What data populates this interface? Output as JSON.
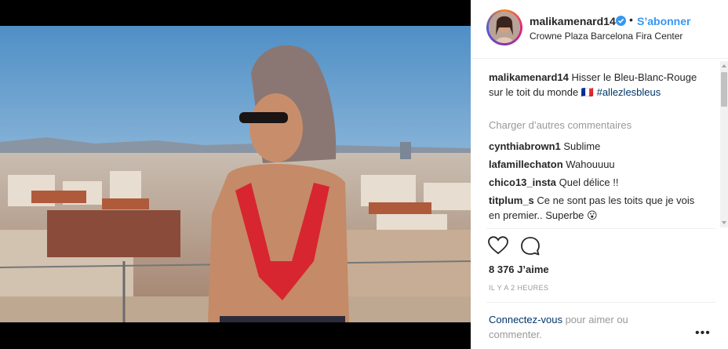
{
  "post": {
    "username": "malikamenard14",
    "follow_label": "S’abonner",
    "separator": "•",
    "location": "Crowne Plaza Barcelona Fira Center"
  },
  "caption": {
    "username": "malikamenard14",
    "text": " Hisser le Bleu-Blanc-Rouge sur le toit du monde 🇫🇷 ",
    "hashtag": "#allezlesbleus"
  },
  "load_more_label": "Charger d’autres commentaires",
  "comments": [
    {
      "username": "cynthiabrown1",
      "text": " Sublime"
    },
    {
      "username": "lafamillechaton",
      "text": " Wahouuuu"
    },
    {
      "username": "chico13_insta",
      "text": " Quel délice !!"
    },
    {
      "username": "titplum_s",
      "text": " Ce ne sont pas les toits que je vois en premier.. Superbe 😮"
    }
  ],
  "likes_text": "8 376 J’aime",
  "timestamp": "IL Y A 2 HEURES",
  "login_prompt": {
    "link": "Connectez-vous",
    "text": " pour aimer ou commenter."
  },
  "more_label": "•••",
  "icons": {
    "like": "heart-icon",
    "comment": "comment-bubble-icon",
    "verified": "verified-badge-icon",
    "more": "more-options-icon"
  },
  "colors": {
    "link_blue": "#3897f0",
    "hashtag_blue": "#003569",
    "muted": "#999999",
    "text": "#262626"
  }
}
